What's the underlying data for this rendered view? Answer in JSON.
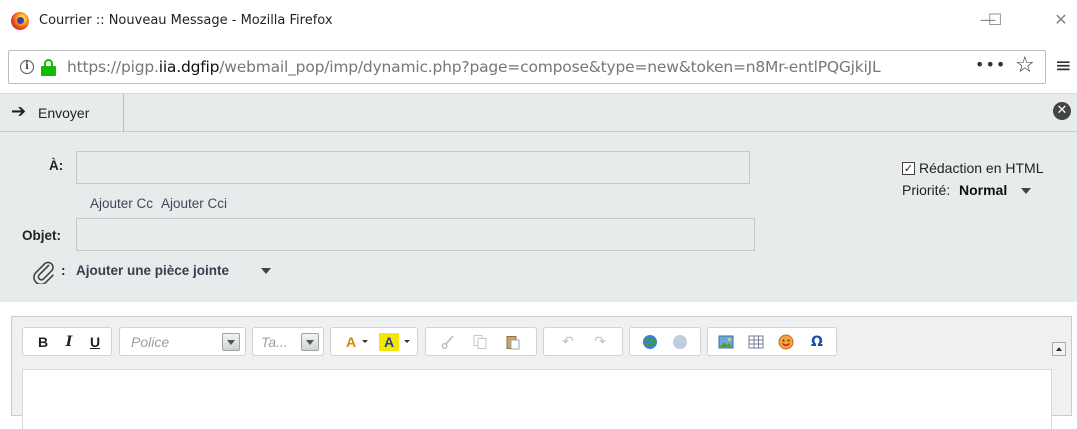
{
  "window": {
    "title": "Courrier :: Nouveau Message - Mozilla Firefox",
    "minimize": "—",
    "maximize": "☐",
    "close": "✕"
  },
  "browser": {
    "url_prefix": "https://pigp.",
    "url_domain": "iia.dgfip",
    "url_rest": "/webmail_pop/imp/dynamic.php?page=compose&type=new&token=n8Mr-entlPQGjkiJL",
    "more_glyph": "•••",
    "star_glyph": "☆",
    "menu_glyph": "≡"
  },
  "compose_toolbar": {
    "send_label": "Envoyer",
    "send_glyph": "➔",
    "close_glyph": "✕"
  },
  "header": {
    "to_label": "À:",
    "to_value": "",
    "add_cc": "Ajouter Cc",
    "add_bcc": "Ajouter Cci",
    "subject_label": "Objet:",
    "subject_value": "",
    "attach_colon": ":",
    "attach_label": "Ajouter une pièce jointe",
    "html_check_glyph": "✓",
    "html_label": "Rédaction en HTML",
    "html_checked": true,
    "priority_label": "Priorité:",
    "priority_value": "Normal"
  },
  "editor_toolbar": {
    "bold": "B",
    "italic": "I",
    "underline": "U",
    "font_placeholder": "Police",
    "size_placeholder": "Ta...",
    "text_color_label": "A",
    "bg_color_label": "A",
    "undo_glyph": "↶",
    "redo_glyph": "↷",
    "special_char_glyph": "Ω",
    "icons": [
      "cut-icon",
      "copy-icon",
      "paste-icon",
      "link-icon",
      "unlink-icon",
      "image-icon",
      "table-icon",
      "smiley-icon",
      "special-char-icon"
    ]
  },
  "editor": {
    "body_text": ""
  }
}
